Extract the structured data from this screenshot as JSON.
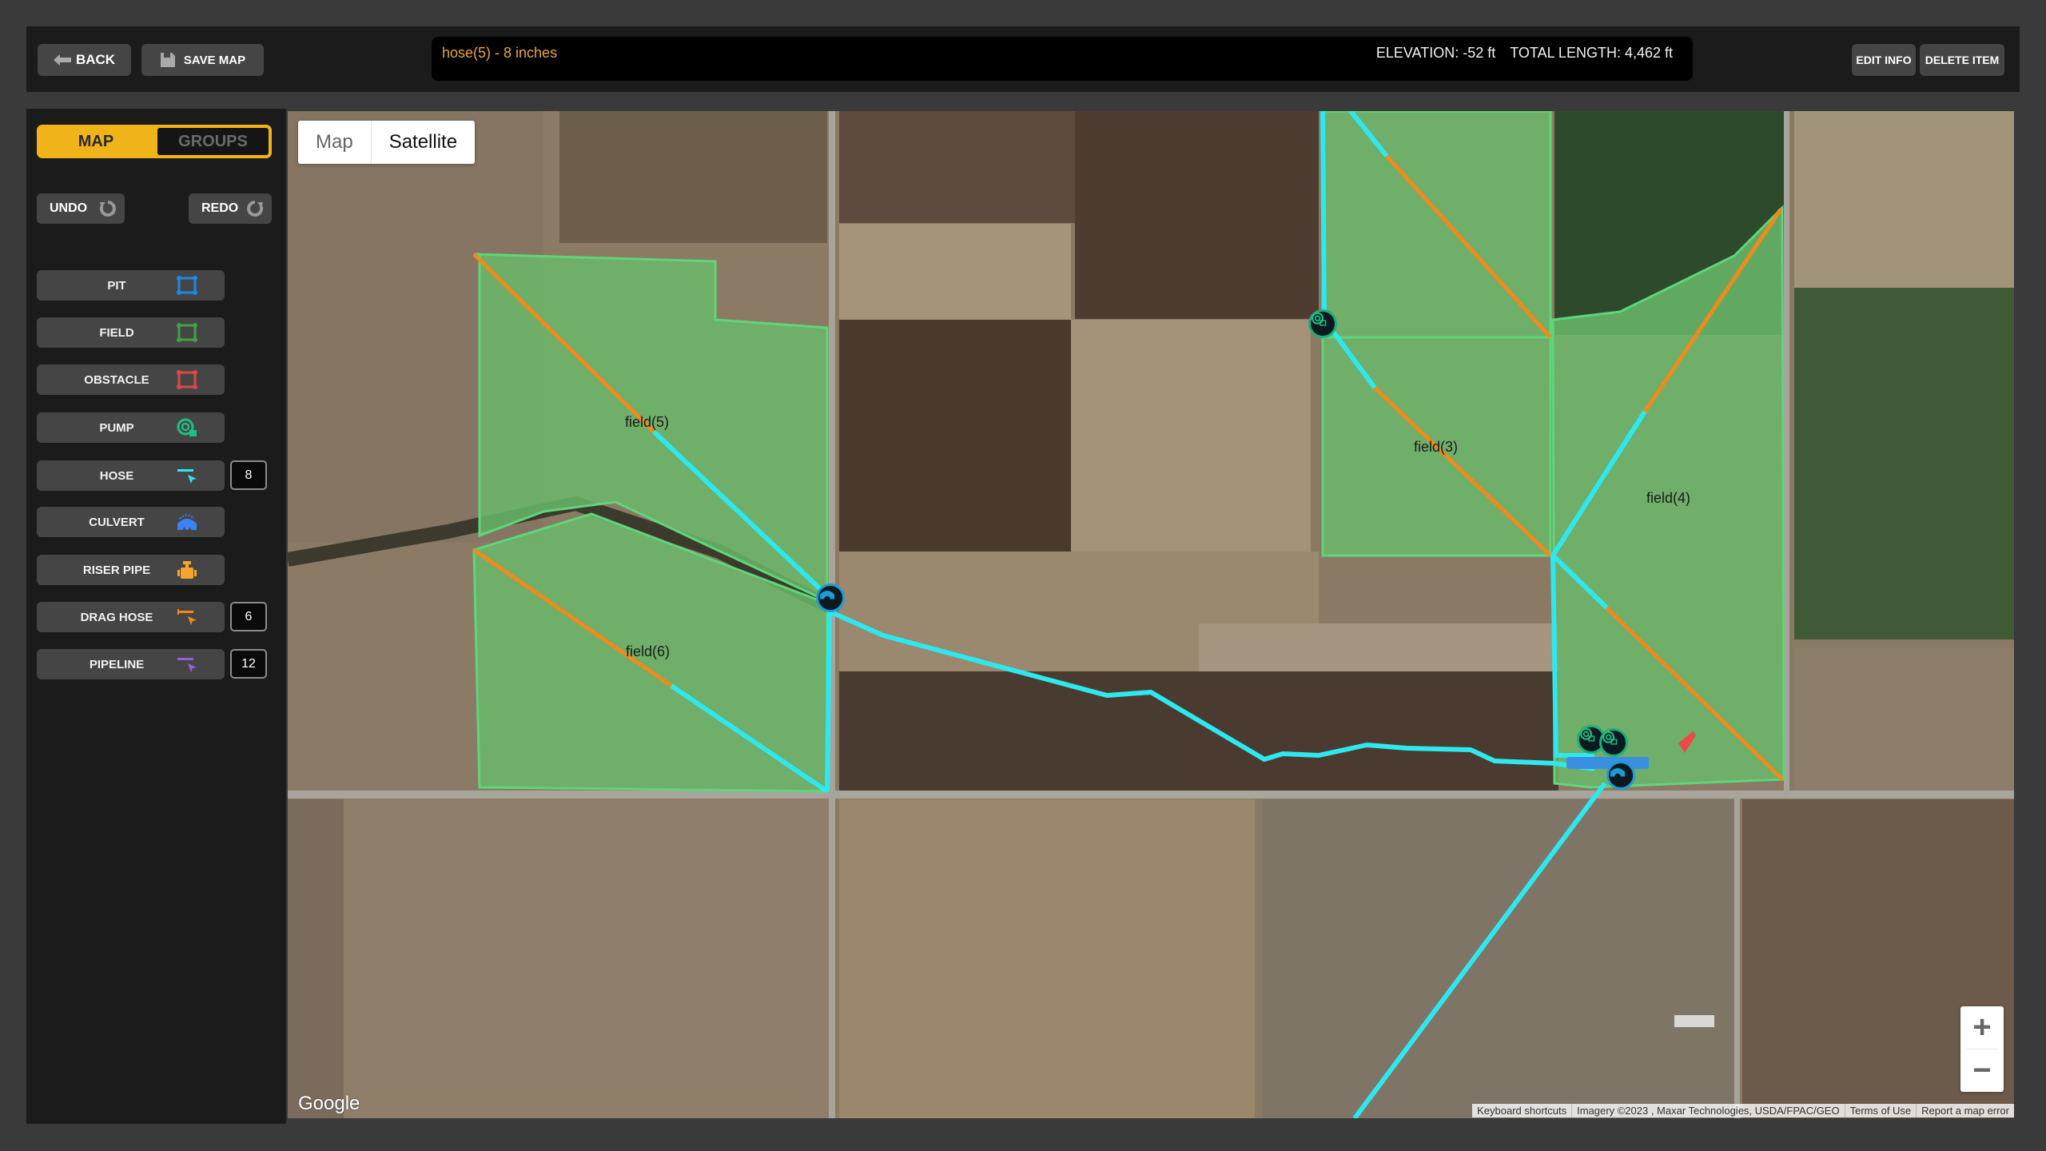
{
  "topbar": {
    "back_label": "BACK",
    "save_label": "SAVE MAP",
    "edit_label": "EDIT INFO",
    "delete_label": "DELETE ITEM",
    "selected_item": "hose(5) - 8 inches",
    "elevation": "ELEVATION: -52 ft",
    "total_length": "TOTAL LENGTH: 4,462 ft"
  },
  "sidebar": {
    "view_toggle": {
      "active": "MAP",
      "options": [
        "MAP",
        "GROUPS"
      ]
    },
    "undo_label": "UNDO",
    "redo_label": "REDO",
    "tools": [
      {
        "label": "PIT",
        "icon": "pit-icon",
        "color": "#1e88e5"
      },
      {
        "label": "FIELD",
        "icon": "field-icon",
        "color": "#43a047"
      },
      {
        "label": "OBSTACLE",
        "icon": "obstacle-icon",
        "color": "#e53935"
      },
      {
        "label": "PUMP",
        "icon": "pump-icon",
        "color": "#1dbf84"
      },
      {
        "label": "HOSE",
        "icon": "hose-icon",
        "color": "#2ee6f0",
        "count": "8"
      },
      {
        "label": "CULVERT",
        "icon": "culvert-icon",
        "color": "#3b82f6"
      },
      {
        "label": "RISER PIPE",
        "icon": "riser-pipe-icon",
        "color": "#f4a52b"
      },
      {
        "label": "DRAG HOSE",
        "icon": "drag-hose-icon",
        "color": "#f08a1c",
        "count": "6"
      },
      {
        "label": "PIPELINE",
        "icon": "pipeline-icon",
        "color": "#a05ce0",
        "count": "12"
      }
    ]
  },
  "map": {
    "type_options": [
      "Map",
      "Satellite"
    ],
    "active_type": "Satellite",
    "fields": [
      {
        "label": "field(5)"
      },
      {
        "label": "field(6)"
      },
      {
        "label": "field(3)"
      },
      {
        "label": "field(4)"
      }
    ],
    "zoom_in": "+",
    "zoom_out": "−",
    "google_logo": "Google",
    "attribution": {
      "shortcuts": "Keyboard shortcuts",
      "imagery": "Imagery ©2023 , Maxar Technologies, USDA/FPAC/GEO",
      "terms": "Terms of Use",
      "report": "Report a map error"
    },
    "colors": {
      "hose": "#2ee8f0",
      "drag_hose": "#f08a1c",
      "field_fill": "#6ab86a",
      "field_stroke": "#5fd67a"
    }
  }
}
